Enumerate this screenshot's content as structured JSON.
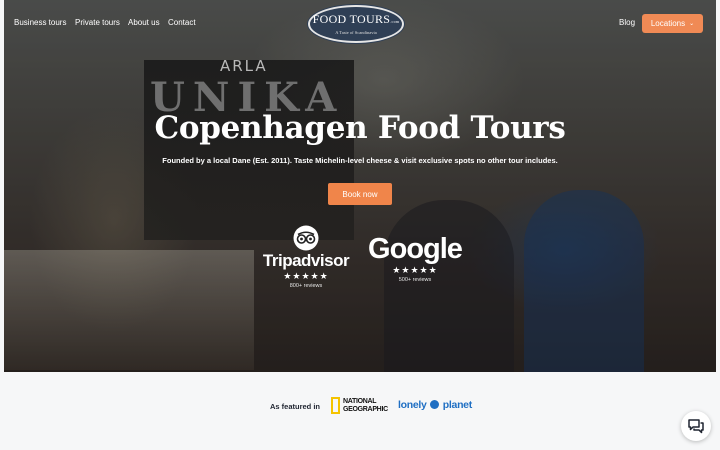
{
  "nav": {
    "links": [
      "Business tours",
      "Private tours",
      "About us",
      "Contact"
    ],
    "blog": "Blog",
    "locations": "Locations",
    "logo": {
      "main": "FOOD TOURS",
      "suffix": ".com",
      "tagline": "A Taste of Scandinavia"
    }
  },
  "hero": {
    "background_signage": [
      "ARLA",
      "UNIKA"
    ],
    "title": "Copenhagen Food Tours",
    "subtitle": "Founded by a local Dane (Est. 2011). Taste Michelin-level cheese & visit exclusive spots no other tour includes.",
    "cta": "Book now"
  },
  "reviews": [
    {
      "name": "Tripadvisor",
      "stars": "★★★★★",
      "count": "800+ reviews",
      "icon": "tripadvisor-owl-icon"
    },
    {
      "name": "Google",
      "stars": "★★★★★",
      "count": "500+ reviews",
      "icon": "google-logo"
    }
  ],
  "featured": {
    "label": "As featured in",
    "natgeo": [
      "NATIONAL",
      "GEOGRAPHIC"
    ],
    "lonely_planet": [
      "lonely",
      "planet"
    ]
  },
  "chat": {
    "icon": "chat-icon"
  },
  "colors": {
    "accent": "#f08a55",
    "lonely_planet_blue": "#1f6fc3",
    "natgeo_yellow": "#f5c400",
    "logo_navy": "#2f3f55"
  }
}
